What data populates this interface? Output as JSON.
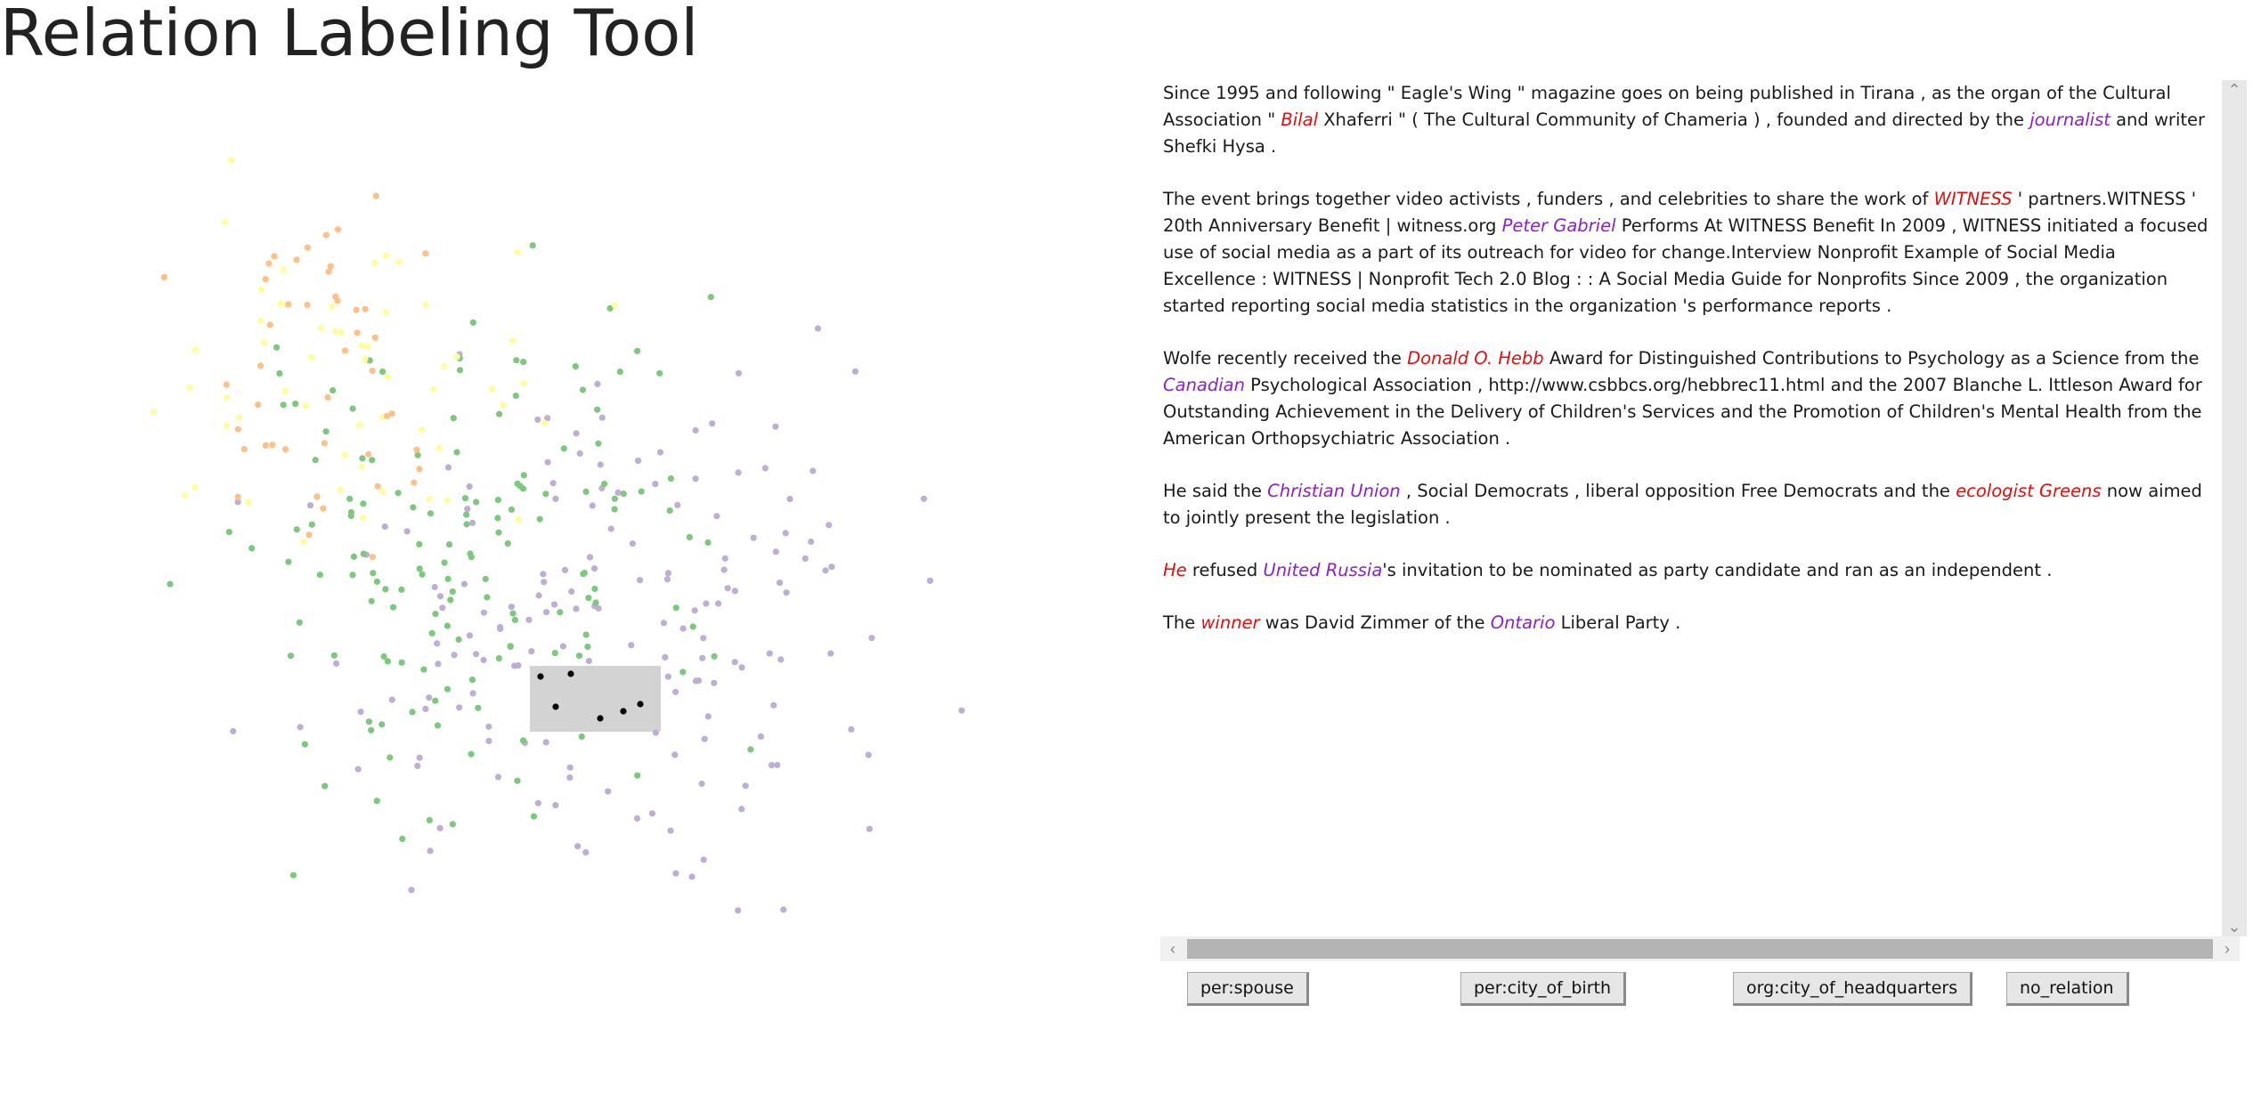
{
  "app": {
    "title": "Relation Labeling Tool"
  },
  "colors": {
    "green": "#7cc87c",
    "purple": "#beaed4",
    "orange": "#fdc086",
    "yellow": "#ffff99",
    "selected": "#000000",
    "selection_box": "#d3d3d3",
    "entity_head": "#e01010",
    "entity_tail": "#8a22c8"
  },
  "sentences": [
    {
      "parts": [
        {
          "t": "Since 1995 and following \" Eagle's Wing \" magazine goes on being published in Tirana , as the organ of the Cultural Association \" "
        },
        {
          "t": "Bilal",
          "e": "head"
        },
        {
          "t": " Xhaferri \" ( The Cultural Community of Chameria ) , founded and directed by the "
        },
        {
          "t": "journalist",
          "e": "tail"
        },
        {
          "t": " and writer Shefki Hysa ."
        }
      ]
    },
    {
      "parts": [
        {
          "t": "The event brings together video activists , funders , and celebrities to share the work of "
        },
        {
          "t": "WITNESS",
          "e": "head"
        },
        {
          "t": " ' partners.WITNESS ' 20th Anniversary Benefit | witness.org "
        },
        {
          "t": "Peter Gabriel",
          "e": "tail"
        },
        {
          "t": " Performs At WITNESS Benefit In 2009 , WITNESS initiated a focused use of social media as a part of its outreach for video for change.Interview Nonprofit Example of Social Media Excellence : WITNESS | Nonprofit Tech 2.0 Blog : : A Social Media Guide for Nonprofits Since 2009 , the organization started reporting social media statistics in the organization 's performance reports ."
        }
      ]
    },
    {
      "parts": [
        {
          "t": "Wolfe recently received the "
        },
        {
          "t": "Donald O. Hebb",
          "e": "head"
        },
        {
          "t": " Award for Distinguished Contributions to Psychology as a Science from the "
        },
        {
          "t": "Canadian",
          "e": "tail"
        },
        {
          "t": " Psychological Association , http://www.csbbcs.org/hebbrec11.html and the 2007 Blanche L. Ittleson Award for Outstanding Achievement in the Delivery of Children's Services and the Promotion of Children's Mental Health from the American Orthopsychiatric Association ."
        }
      ]
    },
    {
      "parts": [
        {
          "t": "He said the "
        },
        {
          "t": "Christian Union",
          "e": "tail"
        },
        {
          "t": " , Social Democrats , liberal opposition Free Democrats and the "
        },
        {
          "t": "ecologist Greens",
          "e": "head"
        },
        {
          "t": " now aimed to jointly present the legislation ."
        }
      ]
    },
    {
      "parts": [
        {
          "t": "He",
          "e": "head"
        },
        {
          "t": " refused "
        },
        {
          "t": "United Russia",
          "e": "tail"
        },
        {
          "t": "'s invitation to be nominated as party candidate and ran as an independent ."
        }
      ]
    },
    {
      "parts": [
        {
          "t": "The "
        },
        {
          "t": "winner",
          "e": "head"
        },
        {
          "t": " was David Zimmer of the "
        },
        {
          "t": "Ontario",
          "e": "tail"
        },
        {
          "t": " Liberal Party ."
        }
      ]
    }
  ],
  "scrollbars": {
    "up_icon": "chevron-up-icon",
    "down_icon": "chevron-down-icon",
    "left_icon": "chevron-left-icon",
    "right_icon": "chevron-right-icon"
  },
  "buttons": {
    "per_spouse": "per:spouse",
    "per_city_of_birth": "per:city_of_birth",
    "org_city_of_headquarters": "org:city_of_headquarters",
    "no_relation": "no_relation"
  }
}
